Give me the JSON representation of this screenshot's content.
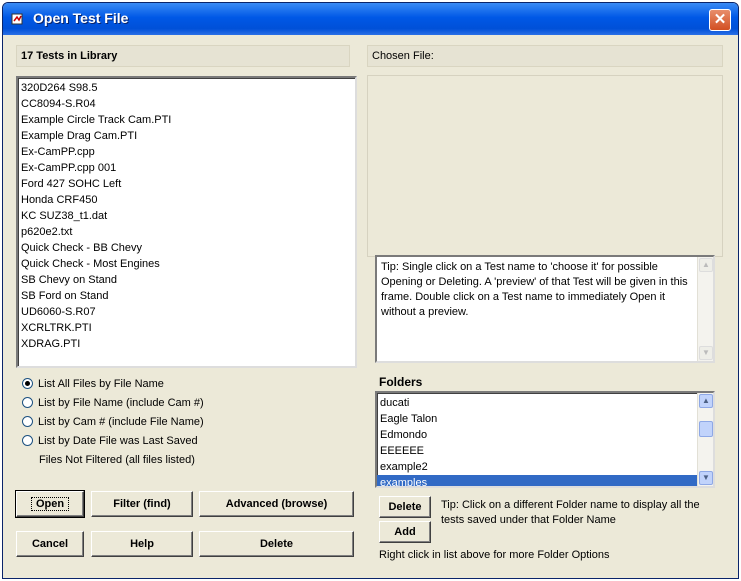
{
  "window": {
    "title": "Open Test File",
    "close_symbol": "✕"
  },
  "library": {
    "header": "17 Tests in Library",
    "files": [
      "320D264 S98.5",
      "CC8094-S.R04",
      "Example Circle Track Cam.PTI",
      "Example Drag Cam.PTI",
      "Ex-CamPP.cpp",
      "Ex-CamPP.cpp 001",
      "Ford 427 SOHC Left",
      "Honda CRF450",
      "KC SUZ38_t1.dat",
      "p620e2.txt",
      "Quick Check - BB Chevy",
      "Quick Check - Most Engines",
      "SB Chevy on Stand",
      "SB Ford on Stand",
      "UD6060-S.R07",
      "XCRLTRK.PTI",
      "XDRAG.PTI"
    ]
  },
  "sort_options": {
    "items": [
      "List All Files by File Name",
      "List by File Name (include Cam #)",
      "List by Cam # (include File Name)",
      "List by Date File was Last Saved"
    ],
    "selected_index": 0,
    "filter_status": "Files Not Filtered (all files listed)"
  },
  "buttons": {
    "open": "Open",
    "filter": "Filter (find)",
    "advanced": "Advanced (browse)",
    "cancel": "Cancel",
    "help": "Help",
    "delete": "Delete"
  },
  "chosen_file": {
    "label": "Chosen File:"
  },
  "tip": "Tip: Single click on a Test name to 'choose it' for possible Opening or Deleting. A 'preview' of that Test will be given in this frame.  Double click on a Test name to immediately Open it without a preview.",
  "folders": {
    "title": "Folders",
    "items": [
      "ducati",
      "Eagle Talon",
      "Edmondo",
      "EEEEEE",
      "example2",
      "examples"
    ],
    "selected": "examples",
    "delete_label": "Delete",
    "add_label": "Add",
    "tip": "Tip:  Click on a different Folder name to display all the tests saved under that Folder Name",
    "footer": "Right click in list above for more Folder Options"
  },
  "colors": {
    "selection": "#316ac5",
    "titlebar": "#0058e6",
    "dialog_bg": "#ece9d8"
  }
}
